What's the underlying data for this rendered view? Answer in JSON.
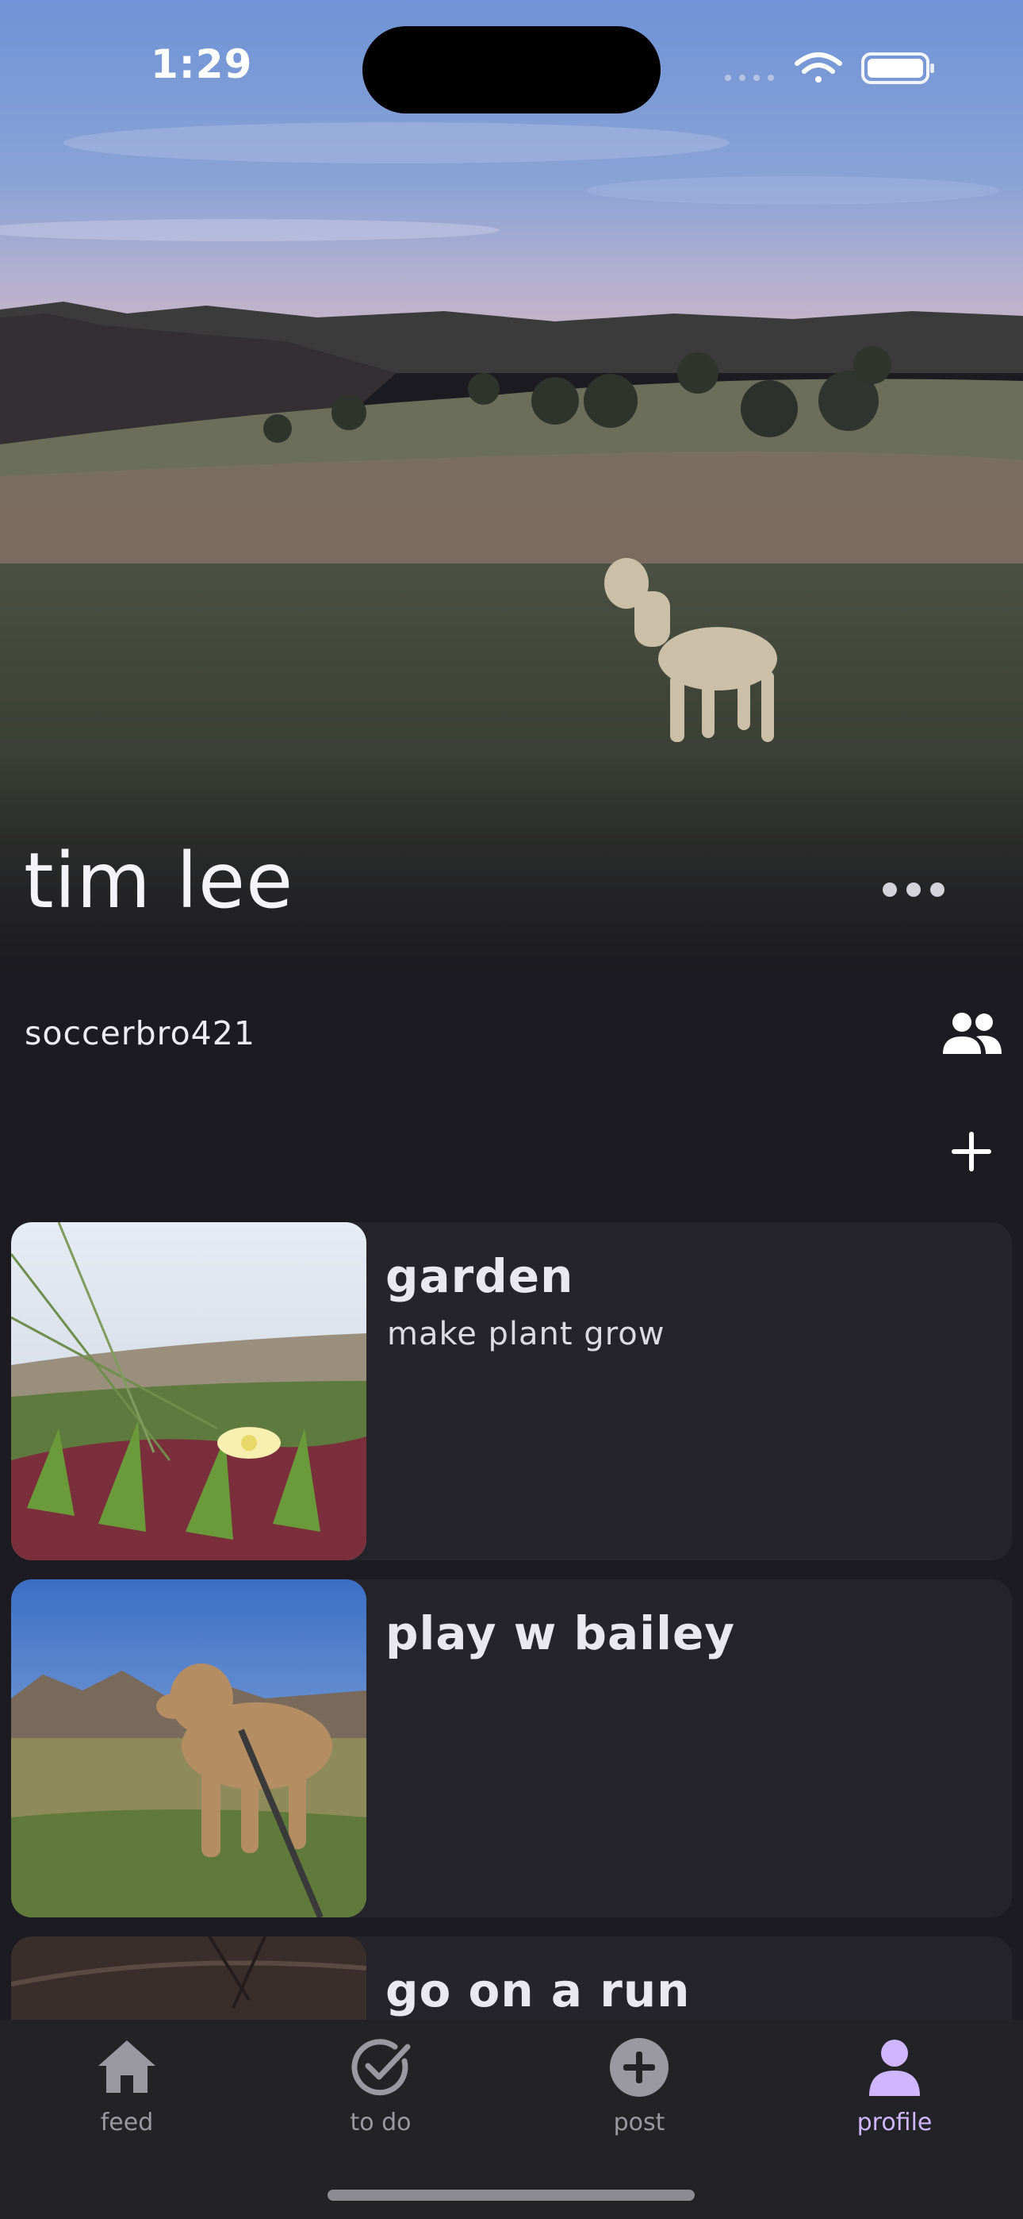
{
  "status_bar": {
    "time": "1:29",
    "icons": [
      "signal-icon",
      "wifi-icon",
      "battery-icon"
    ]
  },
  "profile": {
    "name": "tim lee",
    "username": "soccerbro421",
    "more_icon": "more-horizontal-icon",
    "friends_icon": "friends-icon",
    "add_icon": "plus-icon"
  },
  "cards": [
    {
      "title": "garden",
      "description": "make plant grow"
    },
    {
      "title": "play w bailey",
      "description": ""
    },
    {
      "title": "go on a run",
      "description": ""
    }
  ],
  "tabs": [
    {
      "label": "feed",
      "icon": "home-icon",
      "selected": false
    },
    {
      "label": "to do",
      "icon": "check-circle-icon",
      "selected": false
    },
    {
      "label": "post",
      "icon": "plus-circle-icon",
      "selected": false
    },
    {
      "label": "profile",
      "icon": "person-icon",
      "selected": true
    }
  ],
  "colors": {
    "background": "#1c1b21",
    "card": "#25242b",
    "tabbar": "#232227",
    "accent": "#cfb6ff",
    "inactive_tab": "#9a99a1"
  }
}
